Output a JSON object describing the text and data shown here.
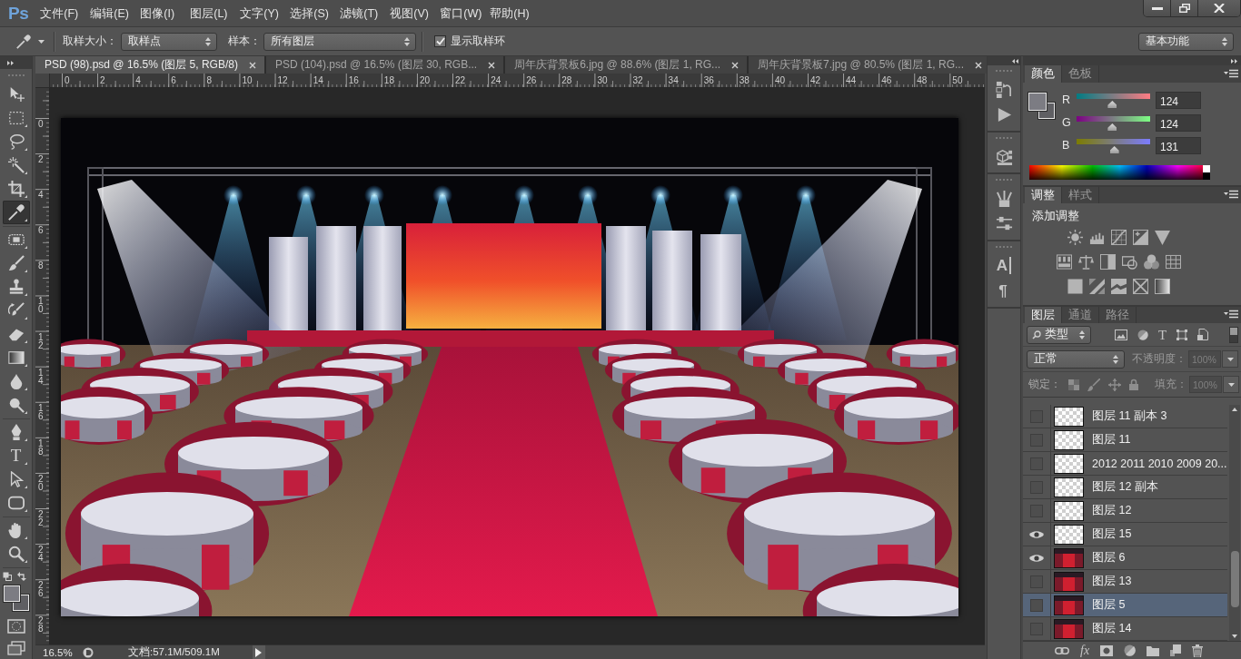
{
  "app": {
    "logo": "Ps"
  },
  "menu": [
    "文件(F)",
    "编辑(E)",
    "图像(I)",
    "图层(L)",
    "文字(Y)",
    "选择(S)",
    "滤镜(T)",
    "视图(V)",
    "窗口(W)",
    "帮助(H)"
  ],
  "options_bar": {
    "sample_size_label": "取样大小：",
    "sample_size": "取样点",
    "sample_label": "样本：",
    "sample": "所有图层",
    "show_ring": {
      "label": "显示取样环",
      "checked": true
    },
    "workspace": "基本功能"
  },
  "tool_groups": [
    [
      {
        "kind": "move",
        "selected": false
      },
      {
        "kind": "marquee",
        "selected": false
      },
      {
        "kind": "lasso",
        "selected": false
      },
      {
        "kind": "wand",
        "selected": false
      },
      {
        "kind": "crop",
        "selected": false
      },
      {
        "kind": "eyedropper",
        "selected": true
      }
    ],
    [
      {
        "kind": "heal",
        "selected": false
      },
      {
        "kind": "brush",
        "selected": false
      },
      {
        "kind": "stamp",
        "selected": false
      },
      {
        "kind": "historybrush",
        "selected": false
      },
      {
        "kind": "eraser",
        "selected": false
      },
      {
        "kind": "gradient",
        "selected": false
      },
      {
        "kind": "blur",
        "selected": false
      },
      {
        "kind": "dodge",
        "selected": false
      }
    ],
    [
      {
        "kind": "pen",
        "selected": false
      },
      {
        "kind": "type",
        "glyph": "T",
        "selected": false
      },
      {
        "kind": "pathselect",
        "selected": false
      },
      {
        "kind": "shape",
        "selected": false
      }
    ],
    [
      {
        "kind": "hand",
        "selected": false
      },
      {
        "kind": "zoom",
        "selected": false
      }
    ]
  ],
  "document_tabs": [
    {
      "label": "PSD (98).psd @ 16.5% (图层 5, RGB/8)",
      "selected": true
    },
    {
      "label": "PSD (104).psd @ 16.5% (图层 30, RGB...",
      "selected": false
    },
    {
      "label": "周年庆背景板6.jpg @ 88.6% (图层 1, RG...",
      "selected": false
    },
    {
      "label": "周年庆背景板7.jpg @ 80.5% (图层 1, RG...",
      "selected": false
    }
  ],
  "rulers": {
    "horizontal": [
      "0",
      "2",
      "4",
      "6",
      "8",
      "10",
      "12",
      "14",
      "16",
      "18",
      "20",
      "22",
      "24",
      "26",
      "28",
      "30",
      "32",
      "34",
      "36",
      "38",
      "40",
      "42",
      "44",
      "46",
      "48",
      "50"
    ],
    "vertical": [
      "0",
      "2",
      "4",
      "6",
      "8",
      "10",
      "12",
      "14",
      "16",
      "18",
      "20",
      "22",
      "24",
      "26",
      "28"
    ]
  },
  "status_bar": {
    "zoom": "16.5%",
    "document": "文档:57.1M/509.1M"
  },
  "dock_groups": [
    [
      {
        "kind": "history"
      },
      {
        "kind": "actions"
      }
    ],
    [
      {
        "kind": "model"
      }
    ],
    [
      {
        "kind": "brushes"
      },
      {
        "kind": "clonesource"
      }
    ],
    [
      {
        "kind": "character",
        "glyph": "A"
      },
      {
        "kind": "paragraph",
        "glyph": "¶"
      }
    ]
  ],
  "color_panel": {
    "tabs": [
      {
        "label": "颜色",
        "selected": true
      },
      {
        "label": "色板",
        "selected": false
      }
    ],
    "channels": [
      {
        "name": "R",
        "value": "124",
        "level": 0.486
      },
      {
        "name": "G",
        "value": "124",
        "level": 0.486
      },
      {
        "name": "B",
        "value": "131",
        "level": 0.514
      }
    ]
  },
  "adjustments_panel": {
    "tabs": [
      {
        "label": "调整",
        "selected": true
      },
      {
        "label": "样式",
        "selected": false
      }
    ],
    "heading": "添加调整"
  },
  "layers_panel": {
    "tabs": [
      {
        "label": "图层",
        "selected": true
      },
      {
        "label": "通道",
        "selected": false
      },
      {
        "label": "路径",
        "selected": false
      }
    ],
    "filter": {
      "value": "类型",
      "type_glyph": "T"
    },
    "blend_mode": "正常",
    "opacity": {
      "label": "不透明度：",
      "value": "100%",
      "disabled": true
    },
    "lock_label": "锁定：",
    "fill": {
      "label": "填充：",
      "value": "100%",
      "disabled": true
    },
    "layers": [
      {
        "name": "图层 11 副本 3",
        "kind": "transparent",
        "visible": false,
        "selected": false
      },
      {
        "name": "图层 11",
        "kind": "transparent",
        "visible": false,
        "selected": false
      },
      {
        "name": "2012 2011 2010 2009 20...",
        "kind": "transparent",
        "visible": false,
        "selected": false
      },
      {
        "name": "图层 12 副本",
        "kind": "transparent",
        "visible": false,
        "selected": false
      },
      {
        "name": "图层 12",
        "kind": "transparent",
        "visible": false,
        "selected": false
      },
      {
        "name": "图层 15",
        "kind": "transparent",
        "visible": true,
        "selected": false
      },
      {
        "name": "图层 6",
        "kind": "scene",
        "visible": true,
        "selected": false
      },
      {
        "name": "图层 13",
        "kind": "scene",
        "visible": false,
        "selected": false
      },
      {
        "name": "图层 5",
        "kind": "scene",
        "visible": false,
        "selected": true
      },
      {
        "name": "图层 14",
        "kind": "scene",
        "visible": false,
        "selected": false
      }
    ],
    "effects_glyph": "fx"
  }
}
